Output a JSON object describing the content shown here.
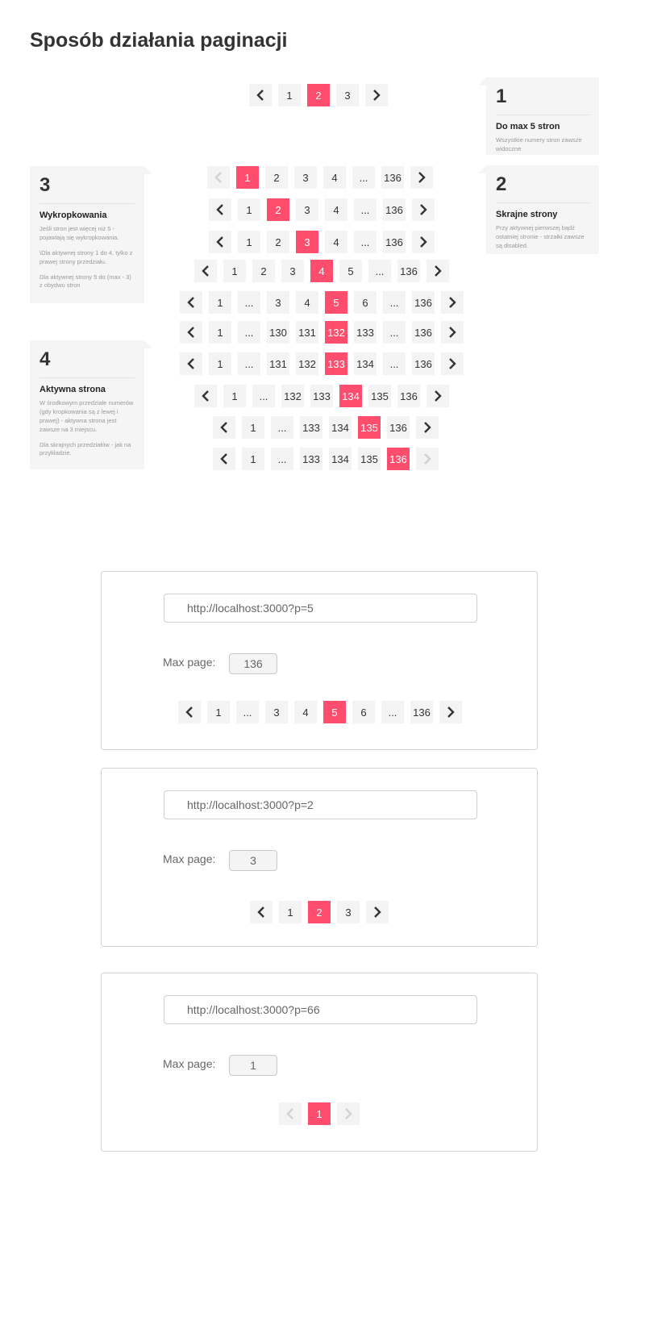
{
  "page_title": "Sposób działania paginacji",
  "colors": {
    "active": "#ff4d6d",
    "button_bg": "#f3f3f3",
    "callout_bg": "#f5f5f5"
  },
  "callouts": [
    {
      "num": "1",
      "heading": "Do max 5 stron",
      "body": [
        "Wszystkie numery stron zawsze widoczne"
      ]
    },
    {
      "num": "2",
      "heading": "Skrajne strony",
      "body": [
        "Przy aktywnej pierwszej bądź ostatniej stronie - strzałki zawsze są disabled."
      ]
    },
    {
      "num": "3",
      "heading": "Wykropkowania",
      "body": [
        "Jeśli stron jest więcej niż 5 - pojawiają się wykropkowania.",
        "\\Dla aktywnej strony 1 do 4, tylko z prawej strony przedziału.",
        "Dla aktywnej strony 5 do (max - 3) z obydwu stron"
      ]
    },
    {
      "num": "4",
      "heading": "Aktywna strona",
      "body": [
        "W środkowym przedziale numerów (gdy kropkowania są z lewej i prawej) - aktywna strona jest zawsze na 3 miejscu.",
        "Dla skrajnych przedziałów - jak na przykładzie."
      ]
    }
  ],
  "example_rows": [
    {
      "items": [
        "<",
        "1",
        "2",
        "3",
        ">"
      ],
      "active": "2",
      "disabled": []
    },
    {
      "items": [
        "<",
        "1",
        "2",
        "3",
        "4",
        "...",
        "136",
        ">"
      ],
      "active": "1",
      "disabled": [
        "<"
      ]
    },
    {
      "items": [
        "<",
        "1",
        "2",
        "3",
        "4",
        "...",
        "136",
        ">"
      ],
      "active": "2",
      "disabled": []
    },
    {
      "items": [
        "<",
        "1",
        "2",
        "3",
        "4",
        "...",
        "136",
        ">"
      ],
      "active": "3",
      "disabled": []
    },
    {
      "items": [
        "<",
        "1",
        "2",
        "3",
        "4",
        "5",
        "...",
        "136",
        ">"
      ],
      "active": "4",
      "disabled": []
    },
    {
      "items": [
        "<",
        "1",
        "...",
        "3",
        "4",
        "5",
        "6",
        "...",
        "136",
        ">"
      ],
      "active": "5",
      "disabled": []
    },
    {
      "items": [
        "<",
        "1",
        "...",
        "130",
        "131",
        "132",
        "133",
        "...",
        "136",
        ">"
      ],
      "active": "132",
      "disabled": []
    },
    {
      "items": [
        "<",
        "1",
        "...",
        "131",
        "132",
        "133",
        "134",
        "...",
        "136",
        ">"
      ],
      "active": "133",
      "disabled": []
    },
    {
      "items": [
        "<",
        "1",
        "...",
        "132",
        "133",
        "134",
        "135",
        "136",
        ">"
      ],
      "active": "134",
      "disabled": []
    },
    {
      "items": [
        "<",
        "1",
        "...",
        "133",
        "134",
        "135",
        "136",
        ">"
      ],
      "active": "135",
      "disabled": []
    },
    {
      "items": [
        "<",
        "1",
        "...",
        "133",
        "134",
        "135",
        "136",
        ">"
      ],
      "active": "136",
      "disabled": [
        ">"
      ]
    }
  ],
  "demos": [
    {
      "url": "http://localhost:3000?p=5",
      "max_label": "Max page:",
      "max_value": "136",
      "pagination": {
        "items": [
          "<",
          "1",
          "...",
          "3",
          "4",
          "5",
          "6",
          "...",
          "136",
          ">"
        ],
        "active": "5",
        "disabled": []
      }
    },
    {
      "url": "http://localhost:3000?p=2",
      "max_label": "Max page:",
      "max_value": "3",
      "pagination": {
        "items": [
          "<",
          "1",
          "2",
          "3",
          ">"
        ],
        "active": "2",
        "disabled": []
      }
    },
    {
      "url": "http://localhost:3000?p=66",
      "max_label": "Max page:",
      "max_value": "1",
      "pagination": {
        "items": [
          "<",
          "1",
          ">"
        ],
        "active": "1",
        "disabled": [
          "<",
          ">"
        ]
      }
    }
  ]
}
